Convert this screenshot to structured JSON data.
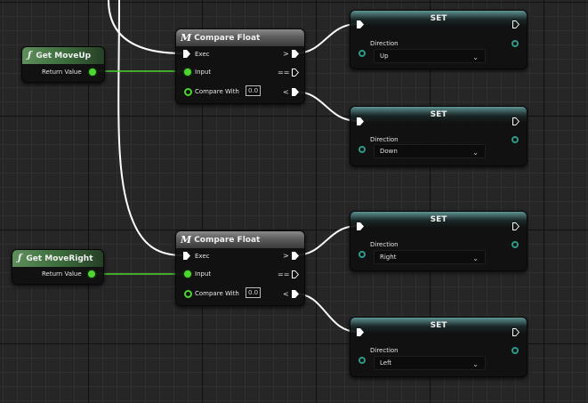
{
  "get_nodes": [
    {
      "title": "Get MoveUp",
      "output_label": "Return Value"
    },
    {
      "title": "Get MoveRight",
      "output_label": "Return Value"
    }
  ],
  "compare_nodes": [
    {
      "title": "Compare Float",
      "exec_label": "Exec",
      "input_label": "Input",
      "compare_label": "Compare With",
      "compare_value": "0.0",
      "out_gt": ">",
      "out_eq": "==",
      "out_lt": "<"
    },
    {
      "title": "Compare Float",
      "exec_label": "Exec",
      "input_label": "Input",
      "compare_label": "Compare With",
      "compare_value": "0.0",
      "out_gt": ">",
      "out_eq": "==",
      "out_lt": "<"
    }
  ],
  "set_nodes": [
    {
      "title": "SET",
      "var_label": "Direction",
      "value": "Up"
    },
    {
      "title": "SET",
      "var_label": "Direction",
      "value": "Down"
    },
    {
      "title": "SET",
      "var_label": "Direction",
      "value": "Right"
    },
    {
      "title": "SET",
      "var_label": "Direction",
      "value": "Left"
    }
  ],
  "icons": {
    "function": "function-icon",
    "macro": "macro-icon",
    "exec_pin": "exec-pin-icon",
    "chevron": "chevron-down-icon"
  },
  "colors": {
    "float_pin": "#4cd62f",
    "exec_wire": "#ffffff",
    "byte_pin": "#2b9a87"
  }
}
